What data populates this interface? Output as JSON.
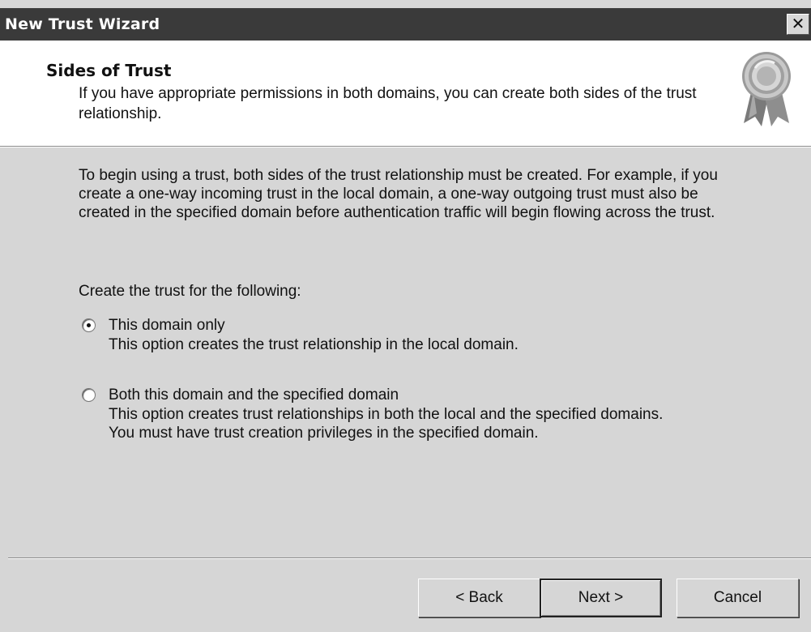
{
  "window": {
    "title": "New Trust Wizard",
    "close_glyph": "✕"
  },
  "header": {
    "title": "Sides of Trust",
    "description": "If you have appropriate permissions in both domains, you can create both sides of the trust relationship.",
    "icon": "certificate-ribbon-icon"
  },
  "body": {
    "intro": "To begin using a trust, both sides of the trust relationship must be created. For example, if you create a one-way incoming trust in the local domain, a one-way outgoing trust must also be created in the specified domain before authentication traffic will begin flowing across the trust.",
    "prompt": "Create the trust for the following:",
    "options": [
      {
        "label": "This domain only",
        "description": "This option creates the trust relationship in the local domain.",
        "selected": true
      },
      {
        "label": "Both this domain and the specified domain",
        "description_line1": "This option creates trust relationships in both the local and the specified domains.",
        "description_line2": "You must have trust creation privileges in the specified domain.",
        "selected": false
      }
    ]
  },
  "buttons": {
    "back": "< Back",
    "next": "Next >",
    "cancel": "Cancel"
  }
}
